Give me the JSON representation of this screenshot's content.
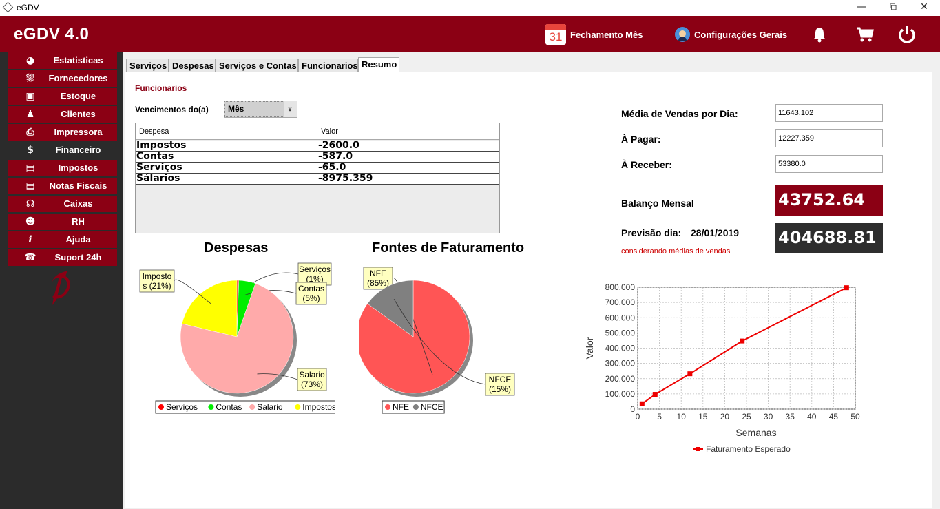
{
  "window": {
    "title": "eGDV"
  },
  "header": {
    "brand": "eGDV 4.0",
    "calendar_day": "31",
    "fechamento_label": "Fechamento Mês",
    "config_label": "Configurações Gerais",
    "bg_color": "#8b0014"
  },
  "sidebar": {
    "items": [
      {
        "label": "Estatisticas",
        "icon": "chart-icon"
      },
      {
        "label": "Fornecedores",
        "icon": "truck-icon"
      },
      {
        "label": "Estoque",
        "icon": "box-icon"
      },
      {
        "label": "Clientes",
        "icon": "user-icon"
      },
      {
        "label": "Impressora",
        "icon": "printer-icon"
      },
      {
        "label": "Financeiro",
        "icon": "dollar-icon"
      },
      {
        "label": "Impostos",
        "icon": "tax-icon"
      },
      {
        "label": "Notas Fiscais",
        "icon": "document-icon"
      },
      {
        "label": "Caixas",
        "icon": "cart-icon"
      },
      {
        "label": "RH",
        "icon": "people-icon"
      },
      {
        "label": "Ajuda",
        "icon": "info-icon"
      },
      {
        "label": "Suport 24h",
        "icon": "headset-icon"
      }
    ]
  },
  "tabs": [
    {
      "label": "Serviços"
    },
    {
      "label": "Despesas"
    },
    {
      "label": "Serviços e Contas"
    },
    {
      "label": "Funcionarios"
    },
    {
      "label": "Resumo"
    }
  ],
  "resumo": {
    "section_title": "Funcionarios",
    "vencimentos_label": "Vencimentos do(a)",
    "vencimentos_value": "Mês",
    "table": {
      "headers": [
        "Despesa",
        "Valor"
      ],
      "rows": [
        [
          "Impostos",
          "-2600.0"
        ],
        [
          "Contas",
          "-587.0"
        ],
        [
          "Serviços",
          "-65.0"
        ],
        [
          "Sálarios",
          "-8975.359"
        ]
      ]
    },
    "media_label": "Média de Vendas por Dia:",
    "media_value": "11643.102",
    "pagar_label": "À Pagar:",
    "pagar_value": "12227.359",
    "receber_label": "À Receber:",
    "receber_value": "53380.0",
    "balanco_label": "Balanço  Mensal",
    "balanco_value": "43752.64",
    "previsao_label": "Previsão dia:",
    "previsao_date": "28/01/2019",
    "previsao_value": "404688.81",
    "previsao_note": "considerando médias de vendas"
  },
  "chart_data": [
    {
      "type": "pie",
      "title": "Despesas",
      "slices": [
        {
          "name": "Serviços",
          "label": "Serviços\n(1%)",
          "value": 65.0,
          "color": "#ff0000"
        },
        {
          "name": "Contas",
          "label": "Contas\n(5%)",
          "value": 587.0,
          "color": "#00ee00"
        },
        {
          "name": "Salario",
          "label": "Salario\n(73%)",
          "value": 8975.359,
          "color": "#ffaaaa"
        },
        {
          "name": "Impostos",
          "label": "Imposto\ns (21%)",
          "value": 2600.0,
          "color": "#ffff00"
        }
      ],
      "legend": "bottom"
    },
    {
      "type": "pie",
      "title": "Fontes de Faturamento",
      "slices": [
        {
          "name": "NFE",
          "label": "NFE\n(85%)",
          "value": 85,
          "color": "#ff5555"
        },
        {
          "name": "NFCE",
          "label": "NFCE\n(15%)",
          "value": 15,
          "color": "#808080"
        }
      ],
      "legend": "bottom"
    },
    {
      "type": "line",
      "title": "",
      "xlabel": "Semanas",
      "ylabel": "Valor",
      "xlim": [
        0,
        50
      ],
      "ylim": [
        0,
        800000
      ],
      "xticks": [
        "0",
        "5",
        "10",
        "15",
        "20",
        "25",
        "30",
        "35",
        "40",
        "45",
        "50"
      ],
      "yticks": [
        "0",
        "100.000",
        "200.000",
        "300.000",
        "400.000",
        "500.000",
        "600.000",
        "700.000",
        "800.000"
      ],
      "grid": true,
      "legend": "bottom",
      "series": [
        {
          "name": "Faturamento Esperado",
          "color": "#ee0000",
          "x": [
            1,
            4,
            12,
            24,
            48
          ],
          "y": [
            35000,
            97000,
            232000,
            447000,
            797000
          ]
        }
      ]
    }
  ]
}
